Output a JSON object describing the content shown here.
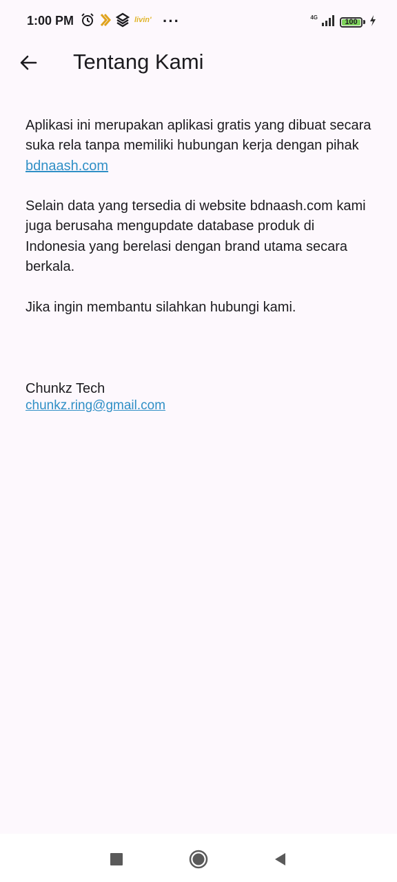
{
  "status_bar": {
    "time": "1:00 PM",
    "left_icons": [
      "alarm-icon",
      "app-notification-icon",
      "app-notification-icon",
      "app-notification-icon"
    ],
    "more": "···",
    "network": "4G",
    "battery": "100",
    "battery_level": 1.0
  },
  "header": {
    "title": "Tentang Kami",
    "back_icon": "arrow-back-icon"
  },
  "content": {
    "p1_text": "Aplikasi ini merupakan aplikasi gratis yang dibuat secara suka rela tanpa memiliki hubungan kerja dengan pihak ",
    "p1_link": "bdnaash.com",
    "p2": "Selain data yang tersedia di website bdnaash.com kami juga berusaha mengupdate database produk di Indonesia yang berelasi dengan brand utama secara berkala.",
    "p3": "Jika ingin membantu silahkan hubungi kami."
  },
  "contact": {
    "name": "Chunkz Tech",
    "email": "chunkz.ring@gmail.com"
  },
  "nav_bar": {
    "buttons": [
      "recents-square-icon",
      "home-circle-icon",
      "back-triangle-icon"
    ]
  },
  "colors": {
    "background": "#fdf8fd",
    "link": "#2f8fc6",
    "text": "#1c1b1f",
    "battery": "#7dd35a"
  }
}
